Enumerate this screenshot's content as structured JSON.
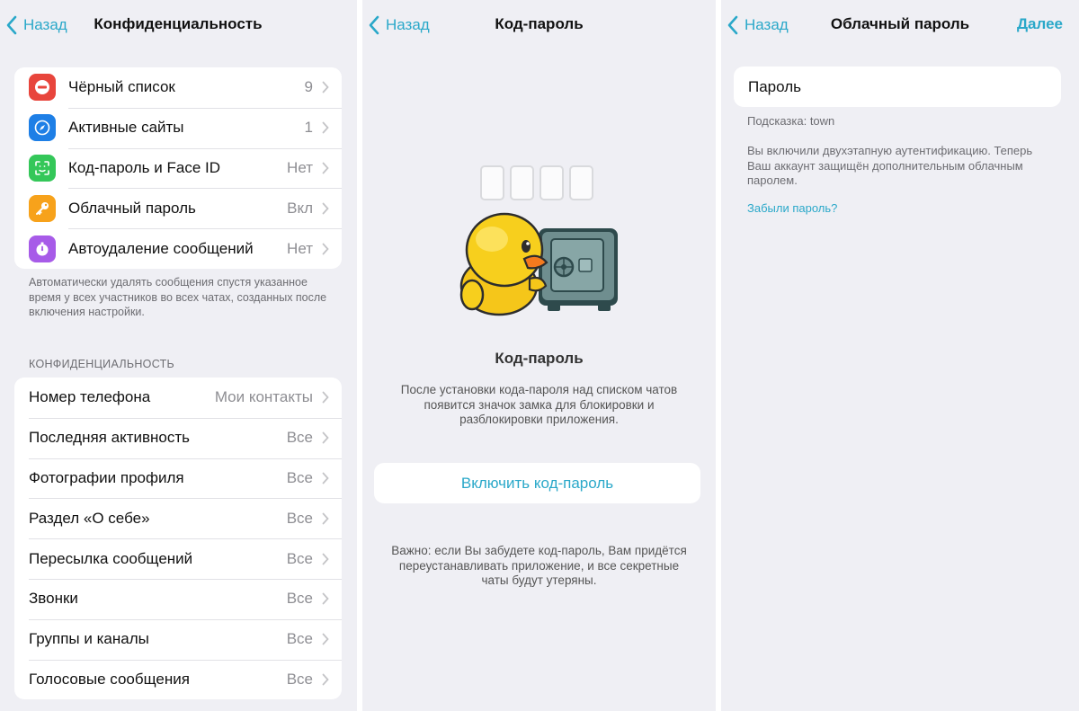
{
  "privacy_screen": {
    "back_label": "Назад",
    "title": "Конфиденциальность",
    "items": [
      {
        "label": "Чёрный список",
        "value": "9",
        "icon": "block-icon",
        "color": "#e8453c"
      },
      {
        "label": "Активные сайты",
        "value": "1",
        "icon": "compass-icon",
        "color": "#1e7fe6"
      },
      {
        "label": "Код-пароль и Face ID",
        "value": "Нет",
        "icon": "faceid-icon",
        "color": "#34c759"
      },
      {
        "label": "Облачный пароль",
        "value": "Вкл",
        "icon": "key-icon",
        "color": "#f7a21b"
      },
      {
        "label": "Автоудаление сообщений",
        "value": "Нет",
        "icon": "timer-icon",
        "color": "#a75be8"
      }
    ],
    "autodelete_note": "Автоматически удалять сообщения спустя указанное время у всех участников во всех чатах, созданных после включения настройки.",
    "section_header": "КОНФИДЕНЦИАЛЬНОСТЬ",
    "privacy_items": [
      {
        "label": "Номер телефона",
        "value": "Мои контакты"
      },
      {
        "label": "Последняя активность",
        "value": "Все"
      },
      {
        "label": "Фотографии профиля",
        "value": "Все"
      },
      {
        "label": "Раздел «О себе»",
        "value": "Все"
      },
      {
        "label": "Пересылка сообщений",
        "value": "Все"
      },
      {
        "label": "Звонки",
        "value": "Все"
      },
      {
        "label": "Группы и каналы",
        "value": "Все"
      },
      {
        "label": "Голосовые сообщения",
        "value": "Все"
      }
    ]
  },
  "passcode_screen": {
    "back_label": "Назад",
    "title": "Код-пароль",
    "heading": "Код-пароль",
    "description": "После установки кода-пароля над списком чатов появится значок замка для блокировки и разблокировки приложения.",
    "enable_button": "Включить код-пароль",
    "warning": "Важно: если Вы забудете код-пароль, Вам придётся переустанавливать приложение, и все секретные чаты будут утеряны."
  },
  "cloud_password_screen": {
    "back_label": "Назад",
    "title": "Облачный пароль",
    "next_label": "Далее",
    "password_placeholder": "Пароль",
    "hint": "Подсказка: town",
    "description": "Вы включили двухэтапную аутентификацию. Теперь Ваш аккаунт защищён дополнительным облачным паролем.",
    "forgot_link": "Забыли пароль?"
  },
  "colors": {
    "accent": "#2aa8c9",
    "background": "#efeff4"
  }
}
